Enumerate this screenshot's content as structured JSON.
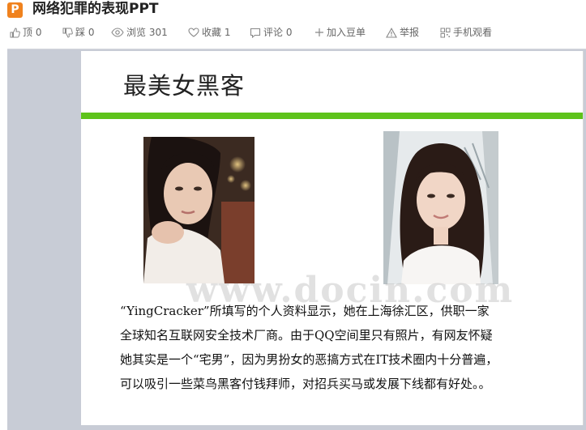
{
  "header": {
    "badge_letter": "P",
    "title": "网络犯罪的表现PPT"
  },
  "toolbar": {
    "up_label": "顶 0",
    "down_label": "踩 0",
    "views_label": "浏览 301",
    "favorite_label": "收藏 1",
    "comment_label": "评论 0",
    "add_label": "加入豆单",
    "report_label": "举报",
    "mobile_label": "手机观看"
  },
  "slide": {
    "title": "最美女黑客",
    "watermark": "www.docin.com",
    "body_lines": [
      "“YingCracker”所填写的个人资料显示，她在上海徐汇区，供职一家",
      "全球知名互联网安全技术厂商。由于QQ空间里只有照片，有网友怀疑",
      "她其实是一个“宅男”，因为男扮女的恶搞方式在IT技术圈内十分普遍，",
      "可以吸引一些菜鸟黑客付钱拜师，对招兵买马或发展下线都有好处。。"
    ],
    "accent_color": "#5ec31b"
  },
  "colors": {
    "badge": "#f0821e",
    "viewer_bg": "#c8ccd6",
    "toolbar_text": "#666666"
  },
  "icons": {
    "up": "thumb-up-icon",
    "down": "thumb-down-icon",
    "views": "eye-icon",
    "favorite": "heart-icon",
    "comment": "comment-icon",
    "add": "plus-icon",
    "report": "warning-icon",
    "mobile": "qr-code-icon"
  }
}
